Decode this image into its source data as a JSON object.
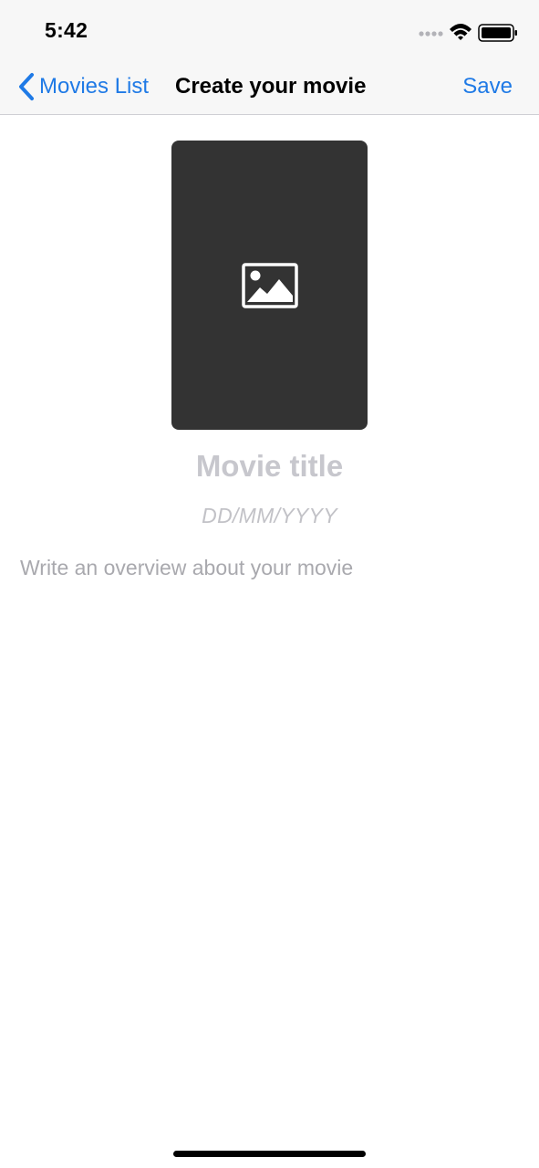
{
  "status_bar": {
    "time": "5:42",
    "icons": [
      "signal-dots-icon",
      "wifi-icon",
      "battery-icon"
    ]
  },
  "nav": {
    "back_icon": "chevron-left-icon",
    "back_label": "Movies List",
    "title": "Create your movie",
    "save_label": "Save"
  },
  "poster": {
    "icon": "image-placeholder-icon"
  },
  "form": {
    "title_placeholder": "Movie title",
    "date_placeholder": "DD/MM/YYYY",
    "overview_placeholder": "Write an overview about your movie"
  },
  "colors": {
    "accent": "#1f7ae6",
    "poster_bg": "#333333",
    "placeholder": "#c7c7cd",
    "overview_placeholder": "#a9a9ae",
    "nav_bg": "#f7f7f7"
  }
}
